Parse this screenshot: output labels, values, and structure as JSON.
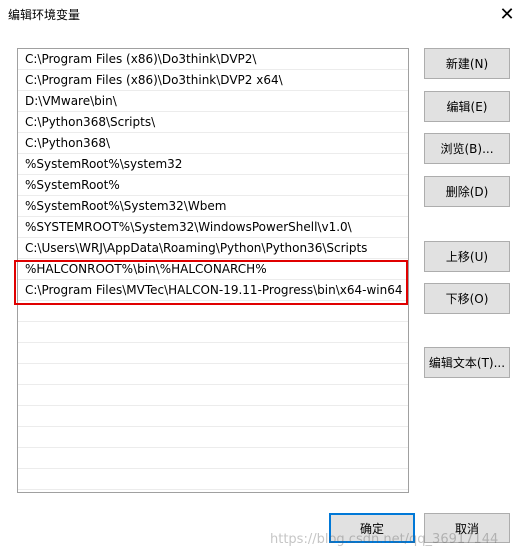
{
  "window": {
    "title": "编辑环境变量",
    "close_glyph": "✕"
  },
  "paths": [
    "C:\\Program Files (x86)\\Do3think\\DVP2\\",
    "C:\\Program Files (x86)\\Do3think\\DVP2 x64\\",
    "D:\\VMware\\bin\\",
    "C:\\Python368\\Scripts\\",
    "C:\\Python368\\",
    "%SystemRoot%\\system32",
    "%SystemRoot%",
    "%SystemRoot%\\System32\\Wbem",
    "%SYSTEMROOT%\\System32\\WindowsPowerShell\\v1.0\\",
    "C:\\Users\\WRJ\\AppData\\Roaming\\Python\\Python36\\Scripts",
    "%HALCONROOT%\\bin\\%HALCONARCH%",
    "C:\\Program Files\\MVTec\\HALCON-19.11-Progress\\bin\\x64-win64"
  ],
  "buttons": {
    "new": "新建(N)",
    "edit": "编辑(E)",
    "browse": "浏览(B)...",
    "delete": "删除(D)",
    "move_up": "上移(U)",
    "move_down": "下移(O)",
    "edit_text": "编辑文本(T)...",
    "ok": "确定",
    "cancel": "取消"
  },
  "watermark": "https://blog.csdn.net/qq_36917144",
  "colors": {
    "highlight_border": "#e00000",
    "default_button_border": "#0078d7"
  }
}
